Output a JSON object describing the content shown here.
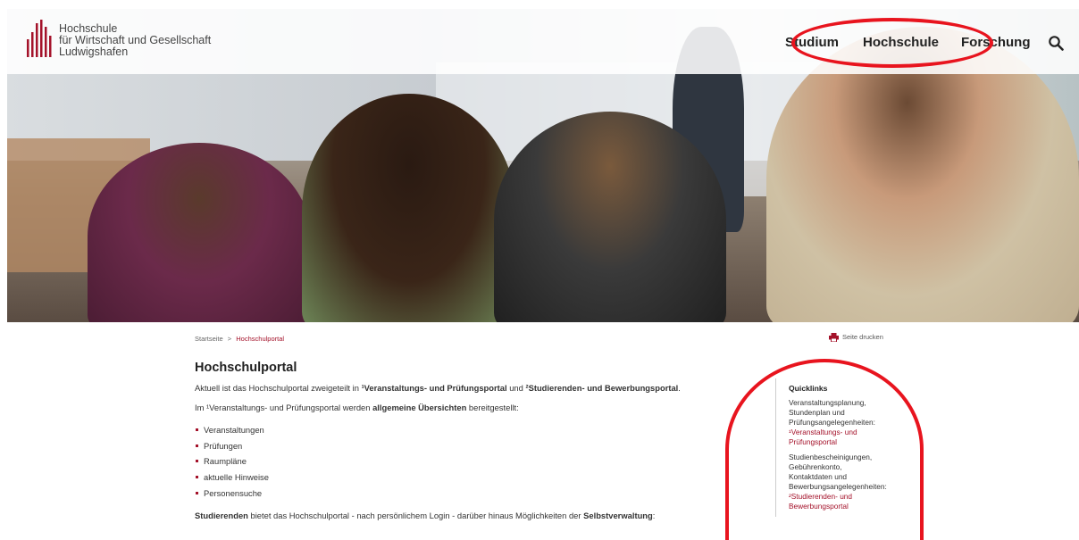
{
  "logo": {
    "lines": [
      "Hochschule",
      "für Wirtschaft und Gesellschaft",
      "Ludwigshafen"
    ]
  },
  "nav": {
    "items": [
      "Studium",
      "Hochschule",
      "Forschung"
    ]
  },
  "breadcrumb": {
    "home": "Startseite",
    "separator": ">",
    "current": "Hochschulportal"
  },
  "print_label": "Seite drucken",
  "main": {
    "title": "Hochschulportal",
    "intro": {
      "pre": "Aktuell ist das Hochschulportal zweigeteilt in ",
      "portal1": "¹Veranstaltungs- und Prüfungsportal",
      "mid": " und ",
      "portal2": "²Studierenden- und Bewerbungsportal",
      "post": "."
    },
    "overview": {
      "pre": "Im ¹Veranstaltungs- und Prüfungsportal werden ",
      "bold": "allgemeine Übersichten",
      "post": " bereitgestellt:"
    },
    "list": [
      "Veranstaltungen",
      "Prüfungen",
      "Raumpläne",
      "aktuelle Hinweise",
      "Personensuche"
    ],
    "students": {
      "bold1": "Studierenden",
      "mid": " bietet das Hochschulportal - nach persönlichem Login - darüber hinaus Möglichkeiten der ",
      "bold2": "Selbstverwaltung",
      "post": ":"
    }
  },
  "quicklinks": {
    "title": "Quicklinks",
    "groups": [
      {
        "desc": [
          "Veranstaltungsplanung,",
          "Stundenplan und",
          "Prüfungsangelegenheiten:"
        ],
        "link": [
          "¹Veranstaltungs- und",
          "Prüfungsportal"
        ]
      },
      {
        "desc": [
          "Studienbescheinigungen,",
          "Gebührenkonto,",
          "Kontaktdaten und",
          "Bewerbungsangelegenheiten:"
        ],
        "link": [
          "²Studierenden- und",
          "Bewerbungsportal"
        ]
      }
    ]
  },
  "colors": {
    "brand_red": "#a4122a",
    "annotation_red": "#e8141e"
  },
  "icons": [
    "logo-mark-icon",
    "search-icon",
    "print-icon"
  ]
}
